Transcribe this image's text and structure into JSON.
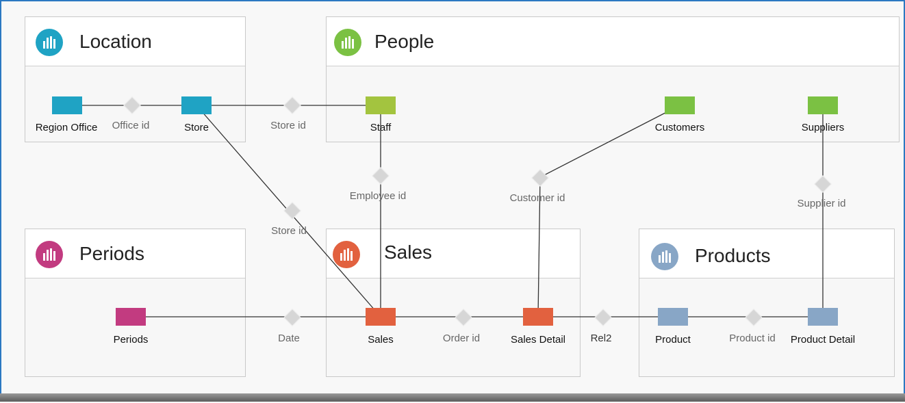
{
  "colors": {
    "location": "#1fa3c4",
    "people": "#7bc143",
    "people_staff": "#a3c43f",
    "periods": "#c23b80",
    "sales": "#e2613f",
    "products": "#88a6c6",
    "diamond": "#d6d6d6",
    "line": "#333333"
  },
  "groups": {
    "location": {
      "title": "Location",
      "icon": "bar-chart-icon"
    },
    "people": {
      "title": "People",
      "icon": "bar-chart-icon"
    },
    "periods": {
      "title": "Periods",
      "icon": "bar-chart-icon"
    },
    "sales": {
      "title": "Sales",
      "icon": "bar-chart-icon"
    },
    "products": {
      "title": "Products",
      "icon": "bar-chart-icon"
    }
  },
  "nodes": {
    "region_office": "Region Office",
    "store": "Store",
    "staff": "Staff",
    "customers": "Customers",
    "suppliers": "Suppliers",
    "periods": "Periods",
    "sales": "Sales",
    "sales_detail": "Sales Detail",
    "product": "Product",
    "product_detail": "Product Detail"
  },
  "relations": {
    "office_id": "Office id",
    "store_id_top": "Store id",
    "employee_id": "Employee id",
    "customer_id": "Customer id",
    "supplier_id": "Supplier id",
    "store_id_diag": "Store id",
    "date": "Date",
    "order_id": "Order id",
    "rel2": "Rel2",
    "product_id": "Product id"
  }
}
